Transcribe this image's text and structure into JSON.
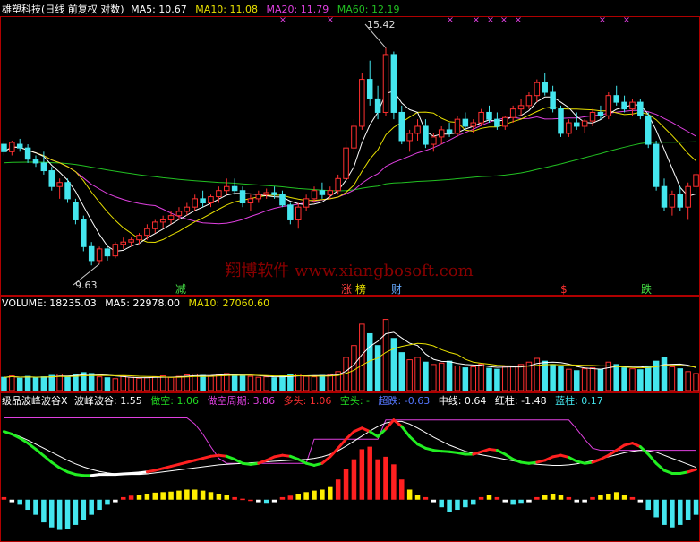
{
  "colors": {
    "bg": "#000000",
    "frame": "#b00000",
    "up": "#ff3030",
    "down": "#44e6ee",
    "ma5": "#ffffff",
    "ma10": "#e8e000",
    "ma20": "#e040e0",
    "ma60": "#22c022",
    "text": "#ffffff",
    "watermark": "#8a0000"
  },
  "price_header": {
    "title": "雄塑科技(日线 前复权 对数)",
    "ma5": "MA5: 10.67",
    "ma10": "MA10: 11.08",
    "ma20": "MA20: 11.79",
    "ma60": "MA60: 12.19"
  },
  "volume_header": {
    "title": "VOLUME: 18235.03",
    "ma5": "MA5: 22978.00",
    "ma10": "MA10: 27060.60"
  },
  "indicator_header": {
    "title": "级品波峰波谷X",
    "p1": "波峰波谷: 1.55",
    "p2": "做空: 1.06",
    "p3": "做空周期: 3.86",
    "p4": "多头: 1.06",
    "p5": "空头: -",
    "p6": "超跌: -0.63",
    "p7": "中线: 0.64",
    "p8": "红柱: -1.48",
    "p9": "蓝柱: 0.17"
  },
  "annotations": {
    "high": "15.42",
    "low": "9.63",
    "tag_jian": "减",
    "tag_zhang": "涨",
    "tag_bang": "榜",
    "tag_cai": "财",
    "tag_s": "$",
    "tag_die": "跌"
  },
  "watermark": "翔博软件 www.xiangbosoft.com",
  "chart_data": {
    "type": "candlestick",
    "scale": "log",
    "price_ylim": [
      9.2,
      16.4
    ],
    "candles": [
      [
        12.5,
        12.6,
        12.2,
        12.3
      ],
      [
        12.3,
        12.6,
        12.2,
        12.55
      ],
      [
        12.5,
        12.65,
        12.3,
        12.4
      ],
      [
        12.4,
        12.5,
        12.0,
        12.1
      ],
      [
        12.1,
        12.2,
        11.9,
        12.0
      ],
      [
        12.0,
        12.3,
        11.7,
        11.8
      ],
      [
        11.8,
        11.9,
        11.3,
        11.4
      ],
      [
        11.4,
        11.6,
        11.1,
        11.5
      ],
      [
        11.5,
        11.6,
        11.0,
        11.1
      ],
      [
        11.0,
        11.1,
        10.5,
        10.6
      ],
      [
        10.6,
        10.7,
        9.9,
        10.0
      ],
      [
        10.0,
        10.1,
        9.6,
        9.7
      ],
      [
        9.7,
        10.0,
        9.63,
        9.95
      ],
      [
        9.95,
        10.0,
        9.7,
        9.8
      ],
      [
        9.8,
        10.1,
        9.75,
        10.05
      ],
      [
        10.05,
        10.2,
        9.95,
        10.1
      ],
      [
        10.1,
        10.2,
        10.0,
        10.15
      ],
      [
        10.15,
        10.3,
        10.05,
        10.25
      ],
      [
        10.25,
        10.5,
        10.15,
        10.4
      ],
      [
        10.4,
        10.6,
        10.3,
        10.55
      ],
      [
        10.55,
        10.7,
        10.4,
        10.6
      ],
      [
        10.6,
        10.8,
        10.5,
        10.7
      ],
      [
        10.7,
        10.9,
        10.6,
        10.8
      ],
      [
        10.8,
        11.0,
        10.7,
        10.9
      ],
      [
        10.9,
        11.2,
        10.8,
        11.1
      ],
      [
        11.1,
        11.3,
        10.9,
        11.0
      ],
      [
        11.0,
        11.2,
        10.9,
        11.15
      ],
      [
        11.15,
        11.4,
        11.0,
        11.3
      ],
      [
        11.3,
        11.6,
        11.2,
        11.4
      ],
      [
        11.4,
        11.6,
        11.2,
        11.3
      ],
      [
        11.3,
        11.4,
        10.9,
        11.0
      ],
      [
        11.0,
        11.2,
        10.8,
        11.1
      ],
      [
        11.1,
        11.3,
        11.0,
        11.2
      ],
      [
        11.2,
        11.35,
        11.1,
        11.25
      ],
      [
        11.25,
        11.4,
        11.1,
        11.2
      ],
      [
        11.2,
        11.3,
        10.9,
        10.95
      ],
      [
        10.95,
        11.0,
        10.5,
        10.6
      ],
      [
        10.6,
        11.0,
        10.4,
        10.9
      ],
      [
        10.9,
        11.2,
        10.8,
        11.1
      ],
      [
        11.1,
        11.4,
        11.0,
        11.3
      ],
      [
        11.3,
        11.5,
        11.1,
        11.2
      ],
      [
        11.2,
        11.4,
        11.1,
        11.3
      ],
      [
        11.3,
        11.7,
        11.2,
        11.6
      ],
      [
        11.6,
        12.6,
        11.5,
        12.4
      ],
      [
        12.4,
        13.2,
        12.2,
        13.0
      ],
      [
        13.0,
        14.6,
        12.9,
        14.4
      ],
      [
        14.4,
        15.0,
        13.6,
        13.8
      ],
      [
        13.8,
        14.2,
        13.2,
        13.4
      ],
      [
        13.4,
        15.42,
        13.3,
        15.2
      ],
      [
        15.2,
        15.3,
        13.2,
        13.4
      ],
      [
        13.4,
        13.6,
        12.5,
        12.6
      ],
      [
        12.6,
        12.9,
        12.3,
        12.8
      ],
      [
        12.8,
        13.2,
        12.6,
        13.0
      ],
      [
        13.0,
        13.2,
        12.4,
        12.5
      ],
      [
        12.5,
        12.8,
        12.3,
        12.7
      ],
      [
        12.7,
        13.0,
        12.5,
        12.9
      ],
      [
        12.9,
        13.1,
        12.7,
        12.8
      ],
      [
        12.8,
        13.3,
        12.7,
        13.2
      ],
      [
        13.2,
        13.4,
        12.9,
        13.0
      ],
      [
        13.0,
        13.2,
        12.8,
        13.1
      ],
      [
        13.1,
        13.5,
        13.0,
        13.4
      ],
      [
        13.4,
        13.6,
        13.1,
        13.2
      ],
      [
        13.2,
        13.4,
        12.9,
        13.0
      ],
      [
        13.0,
        13.3,
        12.9,
        13.25
      ],
      [
        13.25,
        13.6,
        13.1,
        13.5
      ],
      [
        13.5,
        13.8,
        13.3,
        13.6
      ],
      [
        13.6,
        14.0,
        13.5,
        13.9
      ],
      [
        13.9,
        14.4,
        13.7,
        14.3
      ],
      [
        14.3,
        14.6,
        13.9,
        14.0
      ],
      [
        14.0,
        14.2,
        13.4,
        13.5
      ],
      [
        13.5,
        13.6,
        12.7,
        12.8
      ],
      [
        12.8,
        13.2,
        12.7,
        13.1
      ],
      [
        13.1,
        13.4,
        12.9,
        13.0
      ],
      [
        13.0,
        13.2,
        12.8,
        13.15
      ],
      [
        13.15,
        13.5,
        13.0,
        13.4
      ],
      [
        13.4,
        13.6,
        13.2,
        13.3
      ],
      [
        13.3,
        14.0,
        13.2,
        13.9
      ],
      [
        13.9,
        14.2,
        13.6,
        13.7
      ],
      [
        13.7,
        13.9,
        13.4,
        13.5
      ],
      [
        13.5,
        13.8,
        13.3,
        13.7
      ],
      [
        13.7,
        13.8,
        13.2,
        13.3
      ],
      [
        13.3,
        13.4,
        12.4,
        12.5
      ],
      [
        12.5,
        12.6,
        11.3,
        11.4
      ],
      [
        11.4,
        11.6,
        10.8,
        10.9
      ],
      [
        10.9,
        11.3,
        10.7,
        11.2
      ],
      [
        11.2,
        11.4,
        10.8,
        10.9
      ],
      [
        10.9,
        11.5,
        10.6,
        11.4
      ],
      [
        11.4,
        11.8,
        11.2,
        11.7
      ]
    ],
    "volume": [
      28,
      31,
      26,
      30,
      27,
      29,
      32,
      35,
      30,
      33,
      38,
      36,
      29,
      27,
      25,
      30,
      28,
      26,
      27,
      29,
      31,
      28,
      30,
      33,
      35,
      32,
      30,
      34,
      36,
      33,
      31,
      30,
      28,
      29,
      27,
      31,
      33,
      35,
      30,
      29,
      32,
      34,
      40,
      70,
      95,
      140,
      120,
      95,
      150,
      110,
      80,
      65,
      70,
      60,
      55,
      58,
      62,
      52,
      48,
      50,
      56,
      47,
      45,
      50,
      52,
      55,
      60,
      68,
      62,
      55,
      50,
      45,
      42,
      46,
      48,
      45,
      60,
      55,
      48,
      46,
      44,
      52,
      62,
      70,
      50,
      46,
      40,
      36
    ],
    "volume_ylim": [
      0,
      170
    ],
    "indicator": {
      "white_line": [
        1.35,
        1.31,
        1.25,
        1.18,
        1.1,
        1.02,
        0.94,
        0.86,
        0.78,
        0.71,
        0.65,
        0.6,
        0.56,
        0.53,
        0.51,
        0.5,
        0.5,
        0.5,
        0.51,
        0.53,
        0.55,
        0.57,
        0.59,
        0.61,
        0.63,
        0.65,
        0.67,
        0.69,
        0.7,
        0.71,
        0.72,
        0.73,
        0.74,
        0.75,
        0.76,
        0.77,
        0.78,
        0.79,
        0.8,
        0.82,
        0.85,
        0.9,
        0.97,
        1.06,
        1.16,
        1.26,
        1.36,
        1.45,
        1.52,
        1.55,
        1.55,
        1.5,
        1.42,
        1.33,
        1.24,
        1.16,
        1.08,
        1.02,
        0.96,
        0.92,
        0.89,
        0.86,
        0.83,
        0.8,
        0.77,
        0.74,
        0.72,
        0.7,
        0.69,
        0.68,
        0.68,
        0.69,
        0.71,
        0.74,
        0.77,
        0.81,
        0.85,
        0.89,
        0.93,
        0.96,
        0.98,
        0.97,
        0.94,
        0.88,
        0.82,
        0.76,
        0.7,
        0.64
      ],
      "swing_line": [
        1.35,
        1.3,
        1.22,
        1.12,
        1.0,
        0.87,
        0.74,
        0.63,
        0.55,
        0.5,
        0.48,
        0.48,
        0.5,
        0.5,
        0.5,
        0.51,
        0.52,
        0.53,
        0.55,
        0.58,
        0.62,
        0.66,
        0.7,
        0.74,
        0.78,
        0.82,
        0.86,
        0.88,
        0.86,
        0.8,
        0.72,
        0.7,
        0.72,
        0.78,
        0.85,
        0.88,
        0.86,
        0.8,
        0.72,
        0.68,
        0.72,
        0.85,
        1.02,
        1.2,
        1.35,
        1.42,
        1.35,
        1.25,
        1.4,
        1.58,
        1.45,
        1.25,
        1.1,
        1.02,
        0.98,
        0.96,
        0.95,
        0.93,
        0.9,
        0.9,
        0.95,
        1.0,
        0.98,
        0.9,
        0.8,
        0.74,
        0.72,
        0.74,
        0.78,
        0.85,
        0.88,
        0.84,
        0.76,
        0.72,
        0.74,
        0.8,
        0.88,
        0.98,
        1.08,
        1.12,
        1.05,
        0.9,
        0.72,
        0.58,
        0.52,
        0.52,
        0.55,
        0.6
      ],
      "swing_color": [
        "g",
        "g",
        "g",
        "g",
        "g",
        "g",
        "g",
        "g",
        "g",
        "g",
        "g",
        "w",
        "w",
        "w",
        "w",
        "w",
        "w",
        "w",
        "r",
        "r",
        "r",
        "r",
        "r",
        "r",
        "r",
        "r",
        "r",
        "r",
        "g",
        "g",
        "g",
        "g",
        "r",
        "r",
        "r",
        "r",
        "g",
        "g",
        "g",
        "g",
        "r",
        "r",
        "r",
        "r",
        "r",
        "r",
        "g",
        "g",
        "r",
        "r",
        "g",
        "g",
        "g",
        "g",
        "g",
        "g",
        "g",
        "g",
        "g",
        "r",
        "r",
        "r",
        "g",
        "g",
        "g",
        "g",
        "g",
        "r",
        "r",
        "r",
        "r",
        "g",
        "g",
        "g",
        "r",
        "r",
        "r",
        "r",
        "r",
        "r",
        "g",
        "g",
        "g",
        "g",
        "g",
        "g",
        "r",
        "r"
      ],
      "magenta_line": [
        1.62,
        1.62,
        1.62,
        1.62,
        1.62,
        1.62,
        1.62,
        1.62,
        1.62,
        1.62,
        1.62,
        1.62,
        1.62,
        1.62,
        1.62,
        1.62,
        1.62,
        1.62,
        1.62,
        1.62,
        1.62,
        1.62,
        1.62,
        1.62,
        1.5,
        1.3,
        1.05,
        0.82,
        0.72,
        0.72,
        0.72,
        0.72,
        0.72,
        0.72,
        0.72,
        0.72,
        0.72,
        0.72,
        0.72,
        1.2,
        1.2,
        1.2,
        1.2,
        1.2,
        1.2,
        1.2,
        1.2,
        1.2,
        1.58,
        1.58,
        1.58,
        1.58,
        1.58,
        1.58,
        1.58,
        1.58,
        1.58,
        1.58,
        1.58,
        1.58,
        1.58,
        1.58,
        1.58,
        1.58,
        1.58,
        1.58,
        1.58,
        1.58,
        1.58,
        1.58,
        1.58,
        1.58,
        1.4,
        1.2,
        1.02,
        0.98,
        0.98,
        0.98,
        0.98,
        0.98,
        0.98,
        0.98,
        0.98,
        0.98,
        0.98,
        0.98,
        0.98,
        0.98
      ],
      "bars": [
        0.05,
        -0.05,
        -0.1,
        -0.2,
        -0.3,
        -0.45,
        -0.55,
        -0.6,
        -0.58,
        -0.5,
        -0.4,
        -0.3,
        -0.2,
        -0.1,
        -0.05,
        0.05,
        0.08,
        0.1,
        0.12,
        0.14,
        0.15,
        0.16,
        0.18,
        0.2,
        0.2,
        0.18,
        0.15,
        0.12,
        0.1,
        0.05,
        0.02,
        0.0,
        -0.05,
        -0.08,
        -0.05,
        0.05,
        0.08,
        0.12,
        0.15,
        0.18,
        0.2,
        0.25,
        0.4,
        0.6,
        0.8,
        1.0,
        1.05,
        0.8,
        0.85,
        0.7,
        0.4,
        0.2,
        0.1,
        0.05,
        -0.05,
        -0.15,
        -0.25,
        -0.2,
        -0.15,
        -0.1,
        0.05,
        0.1,
        0.05,
        -0.05,
        -0.1,
        -0.08,
        -0.05,
        0.05,
        0.1,
        0.12,
        0.1,
        0.05,
        -0.05,
        -0.05,
        0.05,
        0.1,
        0.12,
        0.15,
        0.1,
        0.05,
        -0.05,
        -0.2,
        -0.35,
        -0.5,
        -0.55,
        -0.5,
        -0.4,
        -0.3
      ],
      "ylim": [
        -0.75,
        1.7
      ]
    }
  }
}
